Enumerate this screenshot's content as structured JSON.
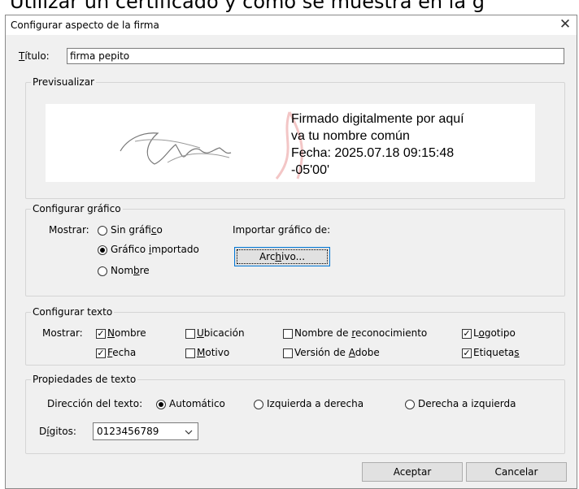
{
  "background_text": "Utilizar un certificado y como se muestra en la g",
  "dialog": {
    "title": "Configurar aspecto de la firma",
    "close_glyph": "✕"
  },
  "title_field": {
    "label_prefix": "T",
    "label_rest": "ítulo:",
    "value": "firma pepito"
  },
  "preview": {
    "group_title": "Previsualizar",
    "lines": [
      "Firmado digitalmente por aquí",
      "va tu nombre común",
      "Fecha: 2025.07.18 09:15:48",
      "-05'00'"
    ]
  },
  "graphic": {
    "group_title": "Configurar gráfico",
    "show_label": "Mostrar:",
    "options": [
      {
        "pre": "Sin gráfi",
        "u": "c",
        "post": "o",
        "selected": false
      },
      {
        "pre": "Gráfico ",
        "u": "i",
        "post": "mportado",
        "selected": true
      },
      {
        "pre": "Nom",
        "u": "b",
        "post": "re",
        "selected": false
      }
    ],
    "import_label": "Importar gráfico de:",
    "file_button": {
      "pre": "Arc",
      "u": "h",
      "post": "ivo..."
    }
  },
  "text_config": {
    "group_title": "Configurar texto",
    "show_label": "Mostrar:",
    "checks": [
      {
        "pre": "",
        "u": "N",
        "post": "ombre",
        "checked": true
      },
      {
        "pre": "",
        "u": "U",
        "post": "bicación",
        "checked": false
      },
      {
        "pre": "Nombre de ",
        "u": "r",
        "post": "econocimiento",
        "checked": false
      },
      {
        "pre": "L",
        "u": "o",
        "post": "gotipo",
        "checked": true
      },
      {
        "pre": "",
        "u": "F",
        "post": "echa",
        "checked": true
      },
      {
        "pre": "",
        "u": "M",
        "post": "otivo",
        "checked": false
      },
      {
        "pre": "Versión de ",
        "u": "A",
        "post": "dobe",
        "checked": false
      },
      {
        "pre": "Etiqueta",
        "u": "s",
        "post": "",
        "checked": true
      }
    ]
  },
  "text_props": {
    "group_title": "Propiedades de texto",
    "direction_label": "Dirección del texto:",
    "directions": [
      {
        "label": "Automático",
        "selected": true
      },
      {
        "label": "Izquierda a derecha",
        "selected": false
      },
      {
        "label": "Derecha a izquierda",
        "selected": false
      }
    ],
    "digits_label_pre": "D",
    "digits_label_u": "í",
    "digits_label_post": "gitos:",
    "digits_value": "0123456789"
  },
  "buttons": {
    "accept": "Aceptar",
    "cancel": "Cancelar"
  }
}
